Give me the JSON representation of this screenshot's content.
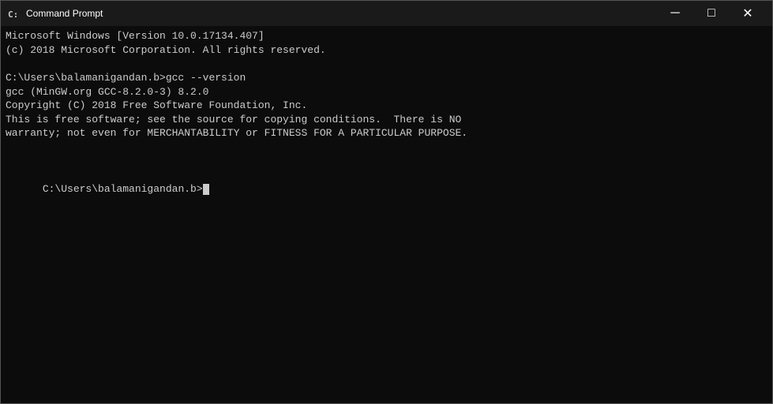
{
  "window": {
    "title": "Command Prompt",
    "icon": "cmd-icon"
  },
  "titlebar": {
    "minimize_label": "─",
    "maximize_label": "□",
    "close_label": "✕"
  },
  "terminal": {
    "line1": "Microsoft Windows [Version 10.0.17134.407]",
    "line2": "(c) 2018 Microsoft Corporation. All rights reserved.",
    "line3": "",
    "line4": "C:\\Users\\balamanigandan.b>gcc --version",
    "line5": "gcc (MinGW.org GCC-8.2.0-3) 8.2.0",
    "line6": "Copyright (C) 2018 Free Software Foundation, Inc.",
    "line7": "This is free software; see the source for copying conditions.  There is NO",
    "line8": "warranty; not even for MERCHANTABILITY or FITNESS FOR A PARTICULAR PURPOSE.",
    "line9": "",
    "line10": "",
    "prompt": "C:\\Users\\balamanigandan.b>"
  }
}
